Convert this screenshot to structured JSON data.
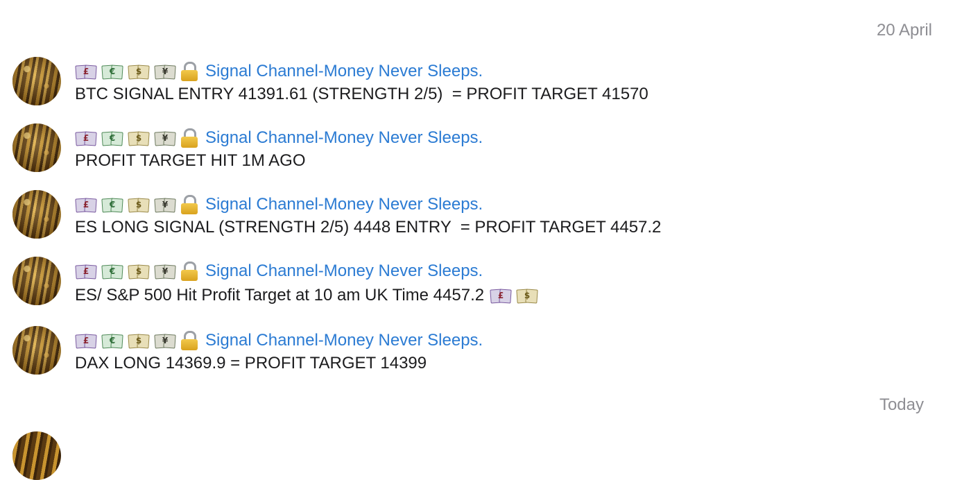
{
  "dates": {
    "top": "20 April",
    "bottom": "Today"
  },
  "sender": {
    "name": "Signal Channel-Money Never Sleeps.",
    "emojis": [
      {
        "icon": "pound-banknote-icon",
        "glyph": "£"
      },
      {
        "icon": "euro-banknote-icon",
        "glyph": "€"
      },
      {
        "icon": "dollar-banknote-icon",
        "glyph": "$"
      },
      {
        "icon": "yen-banknote-icon",
        "glyph": "¥"
      },
      {
        "icon": "lock-icon",
        "glyph": ""
      }
    ]
  },
  "messages": [
    {
      "text": "BTC SIGNAL ENTRY 41391.61 (STRENGTH 2/5)  = PROFIT TARGET 41570"
    },
    {
      "text": "PROFIT TARGET HIT 1M AGO"
    },
    {
      "text": "ES LONG SIGNAL (STRENGTH 2/5) 4448 ENTRY  = PROFIT TARGET 4457.2"
    },
    {
      "text": "ES/ S&P 500 Hit Profit Target at 10 am UK Time 4457.2",
      "trailing_emojis": [
        "pound-banknote-icon",
        "dollar-banknote-icon"
      ]
    },
    {
      "text": "DAX LONG 14369.9 = PROFIT TARGET 14399"
    }
  ]
}
